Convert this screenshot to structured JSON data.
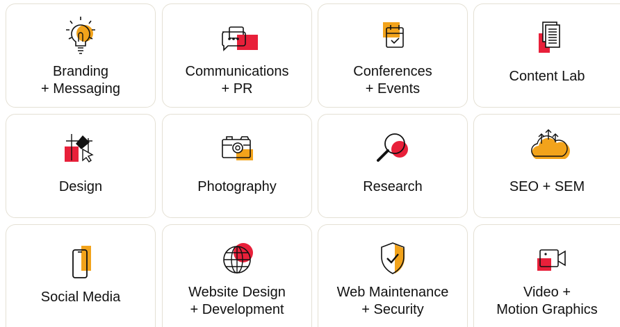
{
  "services": [
    {
      "line1": "Branding",
      "line2": "+ Messaging",
      "icon": "lightbulb-icon"
    },
    {
      "line1": "Communications",
      "line2": "+ PR",
      "icon": "chat-bubbles-icon"
    },
    {
      "line1": "Conferences",
      "line2": "+ Events",
      "icon": "calendar-icon"
    },
    {
      "line1": "Content Lab",
      "icon": "documents-icon"
    },
    {
      "line1": "Design",
      "icon": "design-cursor-icon"
    },
    {
      "line1": "Photography",
      "icon": "camera-icon"
    },
    {
      "line1": "Research",
      "icon": "magnifier-icon"
    },
    {
      "line1": "SEO + SEM",
      "icon": "cloud-growth-icon"
    },
    {
      "line1": "Social Media",
      "icon": "smartphone-icon"
    },
    {
      "line1": "Website Design",
      "line2": "+ Development",
      "icon": "globe-icon"
    },
    {
      "line1": "Web Maintenance",
      "line2": "+ Security",
      "icon": "shield-check-icon"
    },
    {
      "line1": "Video +",
      "line2": "Motion Graphics",
      "icon": "video-camera-icon"
    }
  ],
  "colors": {
    "accent_orange": "#f2a31b",
    "accent_red": "#e8203a",
    "card_border": "#e4e0d4",
    "text": "#111111"
  }
}
